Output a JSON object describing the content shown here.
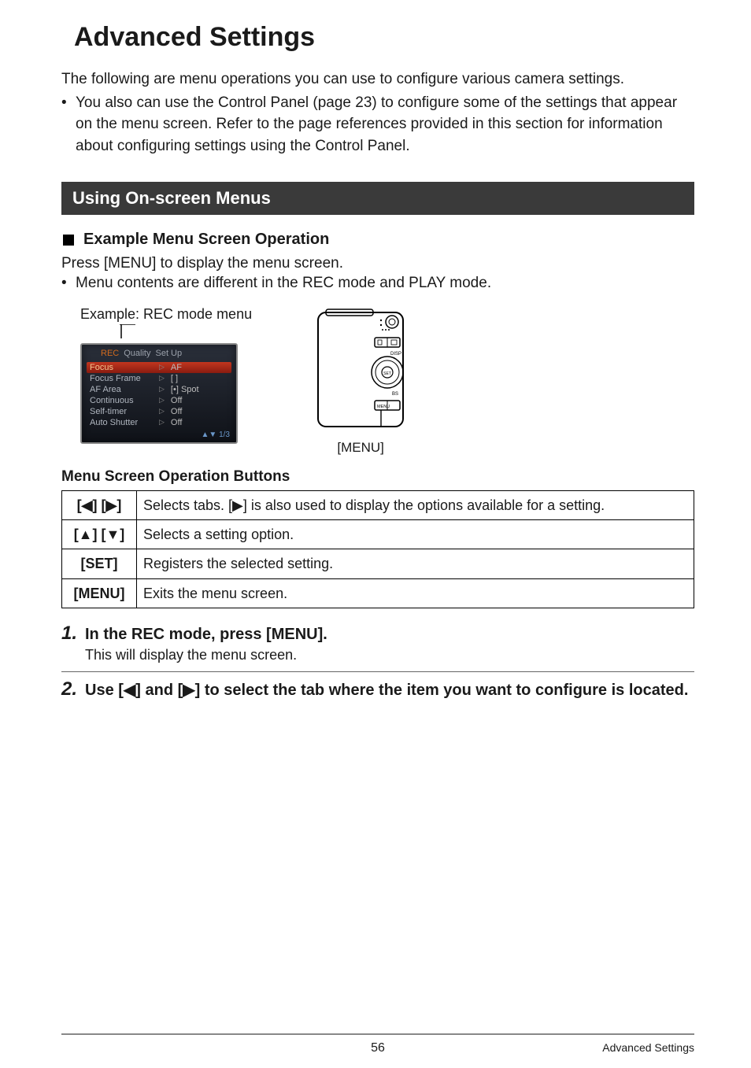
{
  "title": "Advanced Settings",
  "intro": {
    "text": "The following are menu operations you can use to configure various camera settings.",
    "bullet": "You also can use the Control Panel (page 23) to configure some of the settings that appear on the menu screen. Refer to the page references provided in this section for information about configuring settings using the Control Panel."
  },
  "section_bar": "Using On-screen Menus",
  "subheading": "Example Menu Screen Operation",
  "press_text": "Press [MENU] to display the menu screen.",
  "press_bullet": "Menu contents are different in the REC mode and PLAY mode.",
  "example_caption": "Example: REC mode menu",
  "camera_menu": {
    "tabs": {
      "rec": "REC",
      "quality": "Quality",
      "setup": "Set Up"
    },
    "rows": [
      {
        "k": "Focus",
        "v": "AF"
      },
      {
        "k": "Focus Frame",
        "v": "[ ]"
      },
      {
        "k": "AF Area",
        "v": "[•] Spot"
      },
      {
        "k": "Continuous",
        "v": "Off"
      },
      {
        "k": "Self-timer",
        "v": "Off"
      },
      {
        "k": "Auto Shutter",
        "v": "Off"
      }
    ],
    "pager": "▲▼ 1/3"
  },
  "diagram_label": "[MENU]",
  "table_heading": "Menu Screen Operation Buttons",
  "buttons_table": [
    {
      "key": "[◀] [▶]",
      "desc": "Selects tabs. [▶] is also used to display the options available for a setting."
    },
    {
      "key": "[▲] [▼]",
      "desc": "Selects a setting option."
    },
    {
      "key": "[SET]",
      "desc": "Registers the selected setting."
    },
    {
      "key": "[MENU]",
      "desc": "Exits the menu screen."
    }
  ],
  "steps": [
    {
      "num": "1.",
      "text": "In the REC mode, press [MENU].",
      "note": "This will display the menu screen."
    },
    {
      "num": "2.",
      "text": "Use [◀] and [▶] to select the tab where the item you want to configure is located."
    }
  ],
  "footer": {
    "page": "56",
    "title": "Advanced Settings"
  }
}
